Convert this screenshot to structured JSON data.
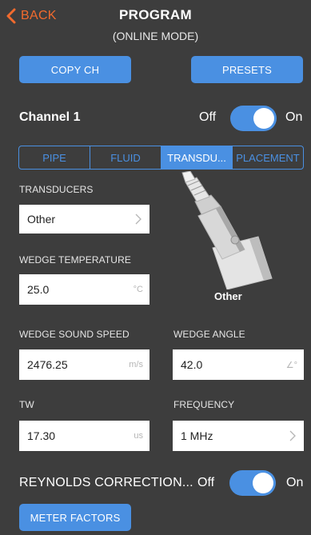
{
  "header": {
    "back_label": "BACK",
    "title": "PROGRAM",
    "subtitle": "(ONLINE MODE)"
  },
  "buttons": {
    "copy_ch": "COPY CH",
    "presets": "PRESETS",
    "meter_factors": "METER FACTORS"
  },
  "channel": {
    "label": "Channel 1",
    "off": "Off",
    "on": "On",
    "state": "on"
  },
  "tabs": [
    {
      "label": "PIPE",
      "active": false
    },
    {
      "label": "FLUID",
      "active": false
    },
    {
      "label": "TRANSDU...",
      "active": true
    },
    {
      "label": "PLACEMENT",
      "active": false
    }
  ],
  "transducers": {
    "label": "TRANSDUCERS",
    "value": "Other",
    "image_caption": "Other"
  },
  "wedge_temperature": {
    "label": "WEDGE TEMPERATURE",
    "value": "25.0",
    "unit": "°C"
  },
  "wedge_sound_speed": {
    "label": "WEDGE SOUND SPEED",
    "value": "2476.25",
    "unit": "m/s"
  },
  "wedge_angle": {
    "label": "WEDGE ANGLE",
    "value": "42.0",
    "unit": "∠°"
  },
  "tw": {
    "label": "TW",
    "value": "17.30",
    "unit": "us"
  },
  "frequency": {
    "label": "FREQUENCY",
    "value": "1 MHz"
  },
  "reynolds": {
    "label": "REYNOLDS CORRECTION...",
    "off": "Off",
    "on": "On",
    "state": "on"
  },
  "colors": {
    "background": "#3d3d3d",
    "accent": "#4a90e2",
    "back": "#f26b2e"
  }
}
